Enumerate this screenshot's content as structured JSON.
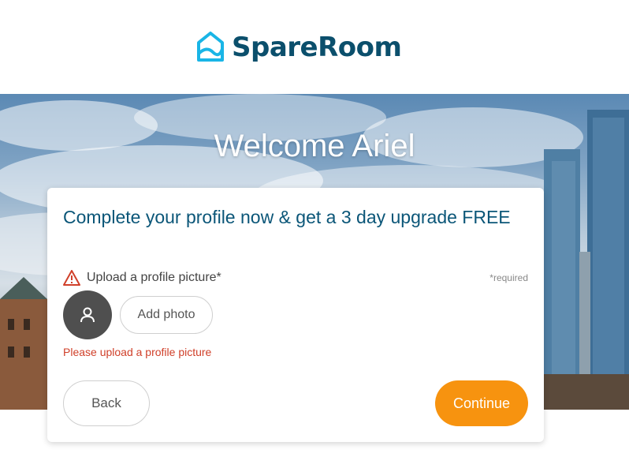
{
  "header": {
    "logo_text": "SpareRoom"
  },
  "hero": {
    "welcome": "Welcome Ariel"
  },
  "card": {
    "title": "Complete your profile now & get a 3 day upgrade FREE",
    "upload_label": "Upload a profile picture*",
    "required_note": "*required",
    "add_photo_label": "Add photo",
    "error_message": "Please upload a profile picture",
    "back_label": "Back",
    "continue_label": "Continue"
  },
  "colors": {
    "brand_blue": "#0b5678",
    "logo_cyan": "#19b5e6",
    "accent_orange": "#f7930f",
    "error_red": "#d0402a"
  },
  "icons": {
    "logo": "house-icon",
    "warning": "warning-triangle-icon",
    "avatar": "person-icon"
  }
}
